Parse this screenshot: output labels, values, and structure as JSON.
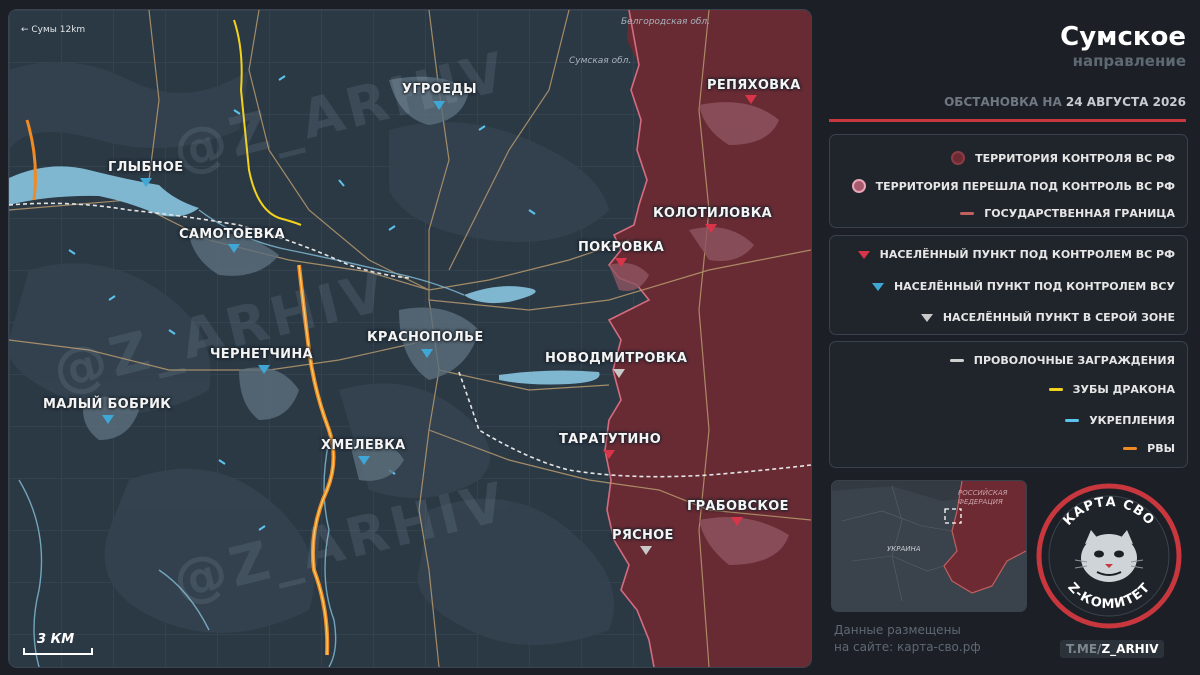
{
  "map": {
    "top_left_label": "← Сумы 12km",
    "region_labels": {
      "belgorod": "Белгородская обл.",
      "sumy": "Сумская обл."
    },
    "watermark": "@Z_ARHIV",
    "scale": "3 КМ",
    "towns": [
      {
        "name": "УГРОЕДЫ",
        "status": "ua"
      },
      {
        "name": "РЕПЯХОВКА",
        "status": "ru"
      },
      {
        "name": "ГЛЫБНОЕ",
        "status": "ua"
      },
      {
        "name": "КОЛОТИЛОВКА",
        "status": "ru"
      },
      {
        "name": "САМОТОЕВКА",
        "status": "ua"
      },
      {
        "name": "ПОКРОВКА",
        "status": "ru"
      },
      {
        "name": "КРАСНОПОЛЬЕ",
        "status": "ua"
      },
      {
        "name": "ЧЕРНЕТЧИНА",
        "status": "ua"
      },
      {
        "name": "НОВОДМИТРОВКА",
        "status": "grey"
      },
      {
        "name": "МАЛЫЙ БОБРИК",
        "status": "ua"
      },
      {
        "name": "ТАРАТУТИНО",
        "status": "ru"
      },
      {
        "name": "ХМЕЛЕВКА",
        "status": "ua"
      },
      {
        "name": "ГРАБОВСКОЕ",
        "status": "ru"
      },
      {
        "name": "РЯСНОЕ",
        "status": "grey"
      }
    ]
  },
  "header": {
    "title": "Сумское",
    "subtitle": "направление",
    "status_prefix": "ОБСТАНОВКА НА ",
    "status_date": "24 АВГУСТА 2026"
  },
  "legend": {
    "territory": [
      {
        "label": "ТЕРРИТОРИЯ КОНТРОЛЯ ВС РФ",
        "color": "#6e2a33"
      },
      {
        "label": "ТЕРРИТОРИЯ ПЕРЕШЛА ПОД КОНТРОЛЬ ВС РФ",
        "color": "#d67b92"
      },
      {
        "label": "ГОСУДАРСТВЕННАЯ ГРАНИЦА",
        "color": "#c25f5f"
      }
    ],
    "settlements": [
      {
        "label": "НАСЕЛЁННЫЙ ПУНКТ ПОД КОНТРОЛЕМ ВС РФ",
        "color": "#d8344a"
      },
      {
        "label": "НАСЕЛЁННЫЙ ПУНКТ ПОД КОНТРОЛЕМ ВСУ",
        "color": "#3fa7d6"
      },
      {
        "label": "НАСЕЛЁННЫЙ ПУНКТ В СЕРОЙ ЗОНЕ",
        "color": "#c9c9c9"
      }
    ],
    "fortifications": [
      {
        "label": "ПРОВОЛОЧНЫЕ ЗАГРАЖДЕНИЯ",
        "color": "#cfcfcf"
      },
      {
        "label": "ЗУБЫ ДРАКОНА",
        "color": "#f2d21b"
      },
      {
        "label": "УКРЕПЛЕНИЯ",
        "color": "#5cc3ee"
      },
      {
        "label": "РВЫ",
        "color": "#f08a24"
      }
    ]
  },
  "inset": {
    "russia_label": "РОССИЙСКАЯ ФЕДЕРАЦИЯ",
    "ukraine_label": "УКРАИНА"
  },
  "badge": {
    "top_text": "КАРТА СВО",
    "bottom_text": "Z-КОМИТЕТ"
  },
  "footer": {
    "line1": "Данные размещены",
    "line2": "на сайте: карта-сво.рф",
    "tme_prefix": "T.ME/",
    "tme_handle": "Z_ARHIV"
  },
  "colors": {
    "ru_territory": "#6e2a33",
    "river": "#7fb7d1",
    "background": "#1c2026",
    "accent_red": "#c7373d"
  }
}
